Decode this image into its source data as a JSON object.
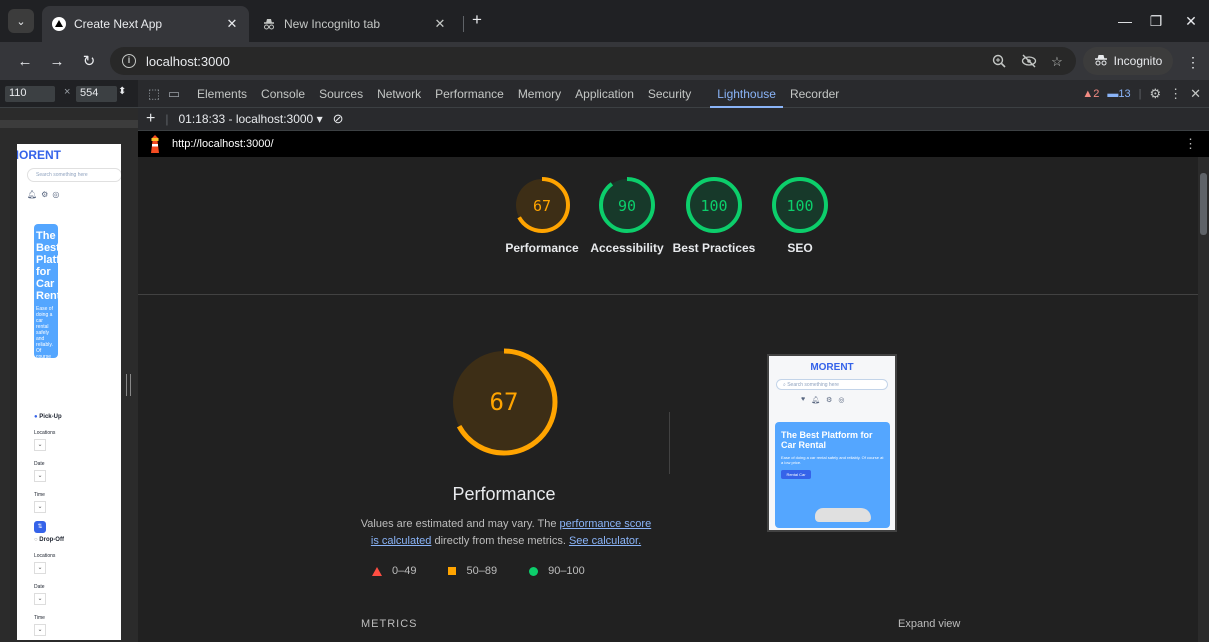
{
  "browser": {
    "tabs": [
      {
        "title": "Create Next App",
        "active": true
      },
      {
        "title": "New Incognito tab",
        "active": false
      }
    ],
    "url": "localhost:3000",
    "incognito_label": "Incognito"
  },
  "device_toolbar": {
    "width": "110",
    "height": "554"
  },
  "devtools": {
    "tabs": [
      "Elements",
      "Console",
      "Sources",
      "Network",
      "Performance",
      "Memory",
      "Application",
      "Security",
      "Lighthouse",
      "Recorder"
    ],
    "active_tab": "Lighthouse",
    "warnings": "2",
    "messages": "13",
    "report_label": "01:18:33 - localhost:3000"
  },
  "report": {
    "url": "http://localhost:3000/",
    "scores": [
      {
        "label": "Performance",
        "value": 67,
        "color": "#ffa400"
      },
      {
        "label": "Accessibility",
        "value": 90,
        "color": "#0cce6b"
      },
      {
        "label": "Best Practices",
        "value": 100,
        "color": "#0cce6b"
      },
      {
        "label": "SEO",
        "value": 100,
        "color": "#0cce6b"
      }
    ],
    "main_score": 67,
    "main_title": "Performance",
    "note_prefix": "Values are estimated and may vary. The ",
    "note_link1": "performance score is calculated",
    "note_middle": " directly from these metrics. ",
    "note_link2": "See calculator.",
    "legend": [
      {
        "range": "0–49",
        "color": "#ff4e42"
      },
      {
        "range": "50–89",
        "color": "#ffa400"
      },
      {
        "range": "90–100",
        "color": "#0cce6b"
      }
    ],
    "metrics_label": "METRICS",
    "expand_label": "Expand view"
  },
  "screenshot": {
    "logo": "MORENT",
    "search_placeholder": "Search something here",
    "banner_title": "The Best Platform for Car Rental",
    "banner_text": "Ease of doing a car rental safely and reliably. Of course at a low price.",
    "banner_button": "Rental Car"
  },
  "phone": {
    "logo": "MORENT",
    "search_placeholder": "Search something here",
    "banner_title": "The Best Platform for Car Rental",
    "banner_text": "Ease of doing a car rental safely and reliably. Of course at a low price.",
    "pickup": "Pick-Up",
    "dropoff": "Drop-Off",
    "location": "Locations",
    "date": "Date",
    "time": "Time"
  }
}
